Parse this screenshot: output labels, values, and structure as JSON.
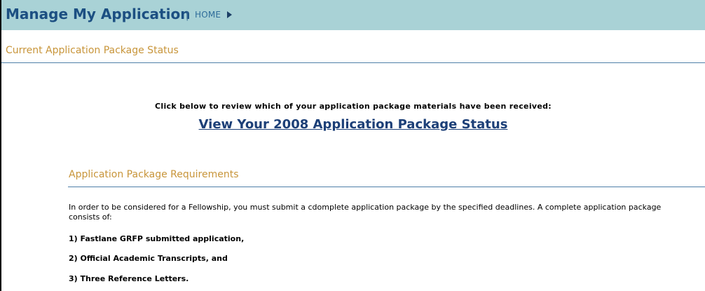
{
  "header": {
    "title": "Manage My Application",
    "separator": "|",
    "home_label": "HOME"
  },
  "status_section": {
    "title": "Current Application Package Status",
    "prompt": "Click below to review which of your application package materials have been received:",
    "link_label": "View Your 2008 Application Package Status"
  },
  "requirements_section": {
    "title": "Application Package Requirements",
    "intro": "In order to be considered for a Fellowship, you must submit a cdomplete application package by the specified deadlines. A complete application package consists of:",
    "items": [
      "1) Fastlane GRFP submitted application,",
      "2) Official Academic Transcripts, and",
      "3) Three Reference Letters."
    ]
  },
  "colors": {
    "header_background": "#a9d2d6",
    "title_blue": "#1c4f82",
    "section_gold": "#c8953a",
    "rule_blue": "#4f7fa8",
    "link_navy": "#1c3f77"
  },
  "icons": {
    "home_arrow": "caret-right-icon"
  }
}
